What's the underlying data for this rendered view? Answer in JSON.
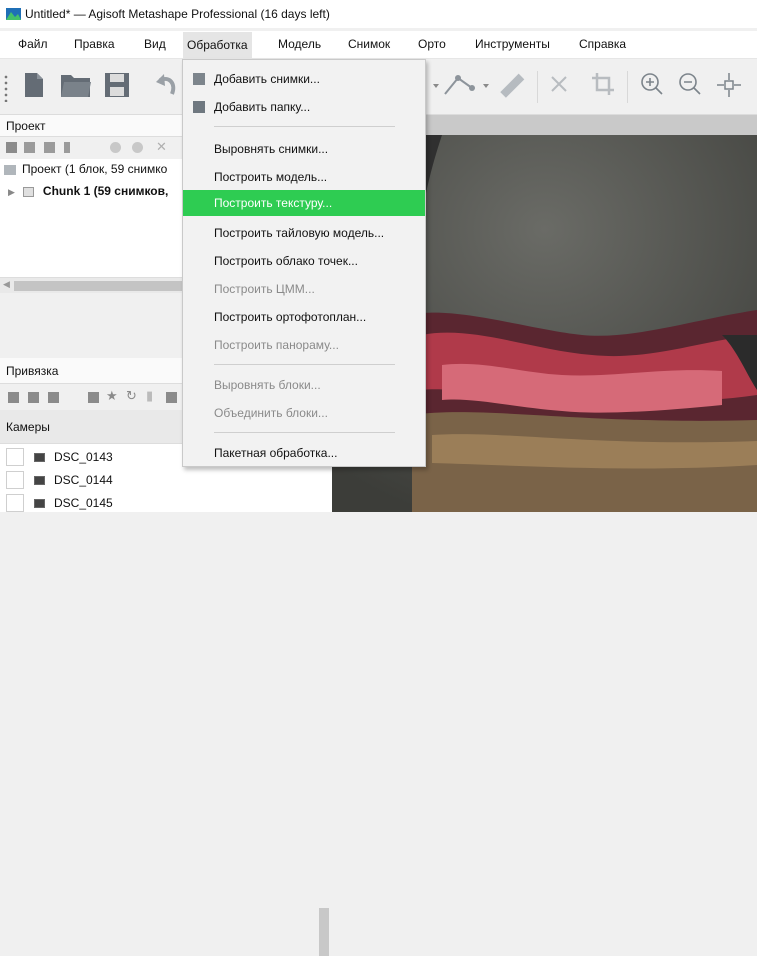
{
  "window": {
    "title": "Untitled* — Agisoft Metashape Professional (16 days left)",
    "accent": "#2ecc52"
  },
  "menubar": {
    "items": [
      "Файл",
      "Правка",
      "Вид",
      "Обработка",
      "Модель",
      "Снимок",
      "Орто",
      "Инструменты",
      "Справка"
    ],
    "active": "Обработка"
  },
  "project_panel": {
    "title": "Проект",
    "tree": {
      "root": "Проект (1 блок, 59 снимко",
      "chunk": "Chunk 1 (59 снимков,"
    }
  },
  "reference_panel": {
    "title": "Привязка"
  },
  "cameras_panel": {
    "title": "Камеры",
    "cameras": [
      "DSC_0143",
      "DSC_0144",
      "DSC_0145"
    ]
  },
  "dropdown": {
    "items": [
      {
        "label": "Добавить снимки...",
        "icon": "add-photos-icon",
        "enabled": true,
        "highlight": false
      },
      {
        "label": "Добавить папку...",
        "icon": "add-folder-icon",
        "enabled": true,
        "highlight": false
      },
      {
        "label": "Выровнять снимки...",
        "enabled": true,
        "highlight": false
      },
      {
        "label": "Построить модель...",
        "enabled": true,
        "highlight": false
      },
      {
        "label": "Построить текстуру...",
        "enabled": true,
        "highlight": true
      },
      {
        "label": "Построить тайловую модель...",
        "enabled": true,
        "highlight": false
      },
      {
        "label": "Построить облако точек...",
        "enabled": true,
        "highlight": false
      },
      {
        "label": "Построить ЦММ...",
        "enabled": false,
        "highlight": false
      },
      {
        "label": "Построить ортофотоплан...",
        "enabled": true,
        "highlight": false
      },
      {
        "label": "Построить панораму...",
        "enabled": false,
        "highlight": false
      },
      {
        "label": "Выровнять блоки...",
        "enabled": false,
        "highlight": false
      },
      {
        "label": "Объединить блоки...",
        "enabled": false,
        "highlight": false
      },
      {
        "label": "Пакетная обработка...",
        "enabled": true,
        "highlight": false
      }
    ]
  }
}
